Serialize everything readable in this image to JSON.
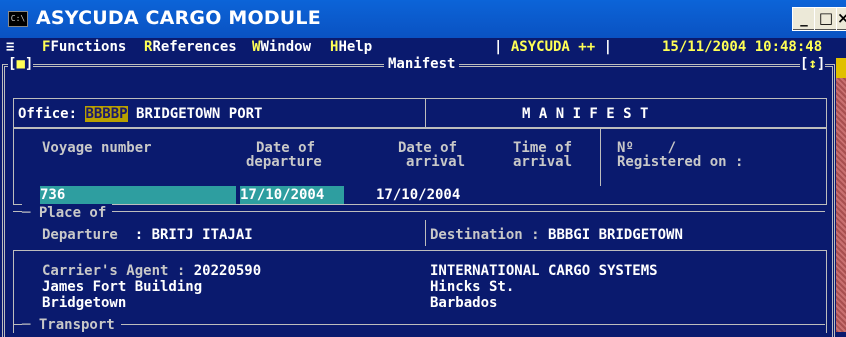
{
  "window": {
    "title": "ASYCUDA CARGO MODULE",
    "icon_text": "C:\\",
    "buttons": {
      "minimize": "_",
      "maximize": "□",
      "close": "×"
    }
  },
  "menu": {
    "system_glyph": "≡",
    "items": [
      "Functions",
      "References",
      "Window",
      "Help"
    ],
    "app_name": "ASYCUDA ++",
    "datetime": "15/11/2004 10:48:48"
  },
  "frame": {
    "left_control": "[■]",
    "title": "Manifest",
    "right_control": "[↕]"
  },
  "office": {
    "label": "Office:",
    "code": "BBBBP",
    "name": "BRIDGETOWN PORT"
  },
  "doc_title": "M A N I F E S T",
  "voyage": {
    "voyage_label": "Voyage number",
    "voyage_value": "736",
    "departure_label_1": "Date of",
    "departure_label_2": "departure",
    "departure_value": "17/10/2004",
    "arrival_label_1": "Date of",
    "arrival_label_2": "arrival",
    "arrival_value": "17/10/2004",
    "time_label_1": "Time of",
    "time_label_2": "arrival",
    "no_label": "Nº",
    "no_sep": "/",
    "registered_label": "Registered on :"
  },
  "place": {
    "section_label": "Place of",
    "departure_label": "Departure",
    "departure_value": ": BRITJ ITAJAI",
    "destination_label": "Destination :",
    "destination_value": "BBBGI BRIDGETOWN"
  },
  "carrier": {
    "agent_label": "Carrier's Agent :",
    "agent_code": "20220590",
    "address_1": "James Fort Building",
    "address_2": "Bridgetown",
    "company": "INTERNATIONAL CARGO SYSTEMS",
    "company_address_1": "Hincks St.",
    "company_address_2": "Barbados"
  },
  "transport": {
    "section_label": "Transport"
  }
}
